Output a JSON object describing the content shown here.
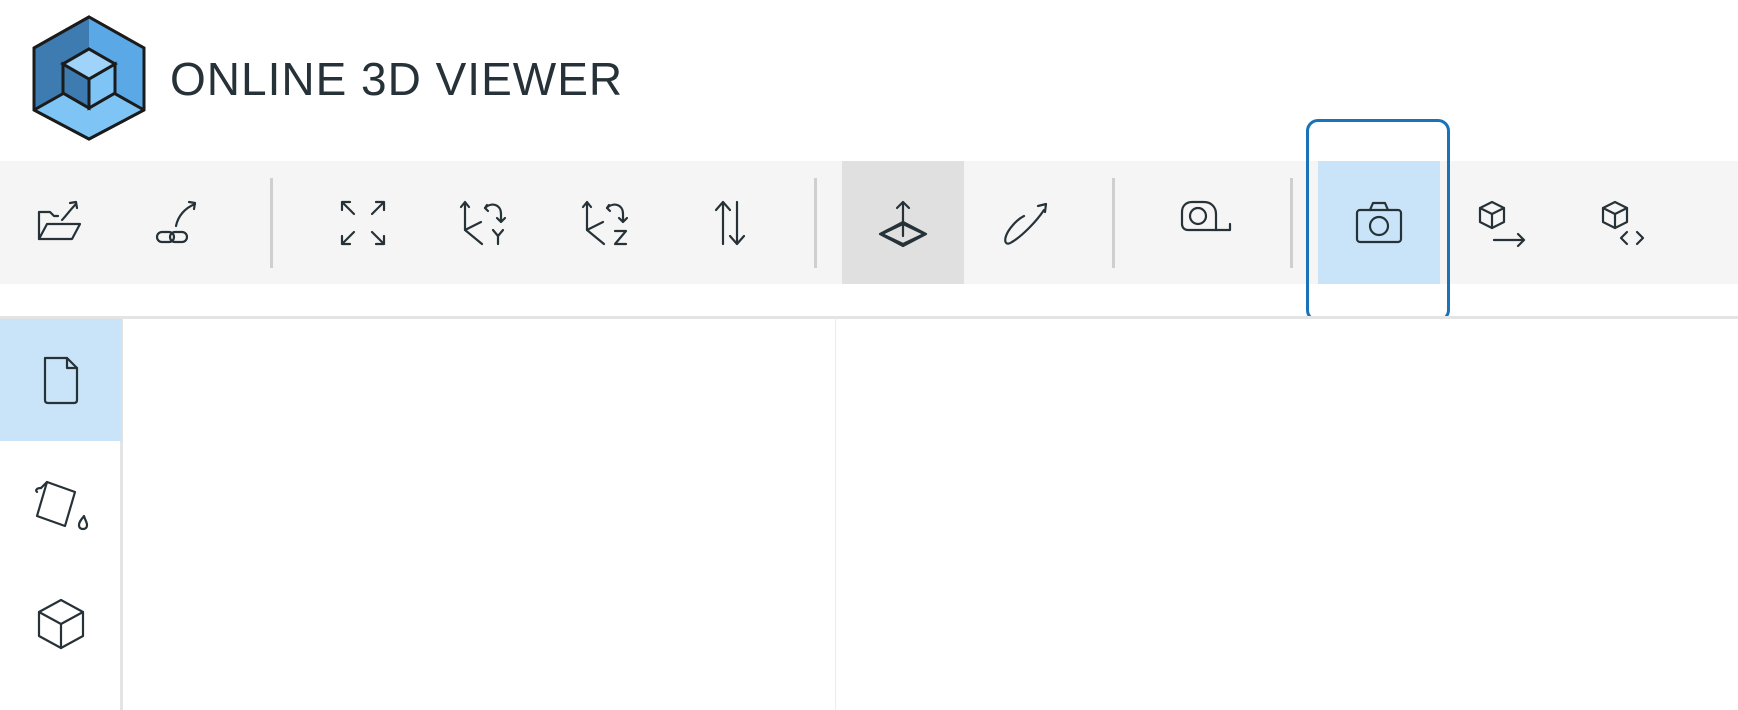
{
  "header": {
    "title": "ONLINE 3D VIEWER",
    "logo_icon": "o3dv-cube-logo-icon",
    "colors": {
      "logo_dark": "#3d7bb0",
      "logo_mid": "#5aa8e6",
      "logo_light": "#7ec4f5"
    }
  },
  "toolbar": {
    "buttons": [
      {
        "id": "open-files",
        "icon": "open-folder-icon",
        "tooltip": "Open from your device"
      },
      {
        "id": "open-url",
        "icon": "link-upload-icon",
        "tooltip": "Open from url"
      },
      {
        "id": "fit-to-window",
        "icon": "fit-window-icon",
        "tooltip": "Fit model to window"
      },
      {
        "id": "y-up",
        "icon": "y-axis-up-icon",
        "tooltip": "Set Y axis as up vector"
      },
      {
        "id": "z-up",
        "icon": "z-axis-up-icon",
        "tooltip": "Set Z axis as up vector"
      },
      {
        "id": "flip-up",
        "icon": "flip-up-vector-icon",
        "tooltip": "Flip up vector"
      },
      {
        "id": "fixed-up",
        "icon": "fixed-up-vector-icon",
        "tooltip": "Fixed up vector",
        "selected": true
      },
      {
        "id": "free-orbit",
        "icon": "free-orbit-icon",
        "tooltip": "Free orbit"
      },
      {
        "id": "measure",
        "icon": "tape-measure-icon",
        "tooltip": "Measure"
      },
      {
        "id": "snapshot",
        "icon": "camera-icon",
        "tooltip": "Create snapshot",
        "highlighted": true
      },
      {
        "id": "export",
        "icon": "export-model-icon",
        "tooltip": "Export"
      },
      {
        "id": "share",
        "icon": "embed-model-icon",
        "tooltip": "Share"
      }
    ],
    "colors": {
      "background": "#f5f5f5",
      "selected": "#e0e0e0",
      "highlight": "#c9e4f8",
      "focus_ring": "#1a73b8"
    }
  },
  "leftnav": {
    "items": [
      {
        "id": "files",
        "icon": "file-icon",
        "active": true
      },
      {
        "id": "materials",
        "icon": "paint-bucket-icon"
      },
      {
        "id": "meshes",
        "icon": "cube-icon"
      }
    ]
  }
}
